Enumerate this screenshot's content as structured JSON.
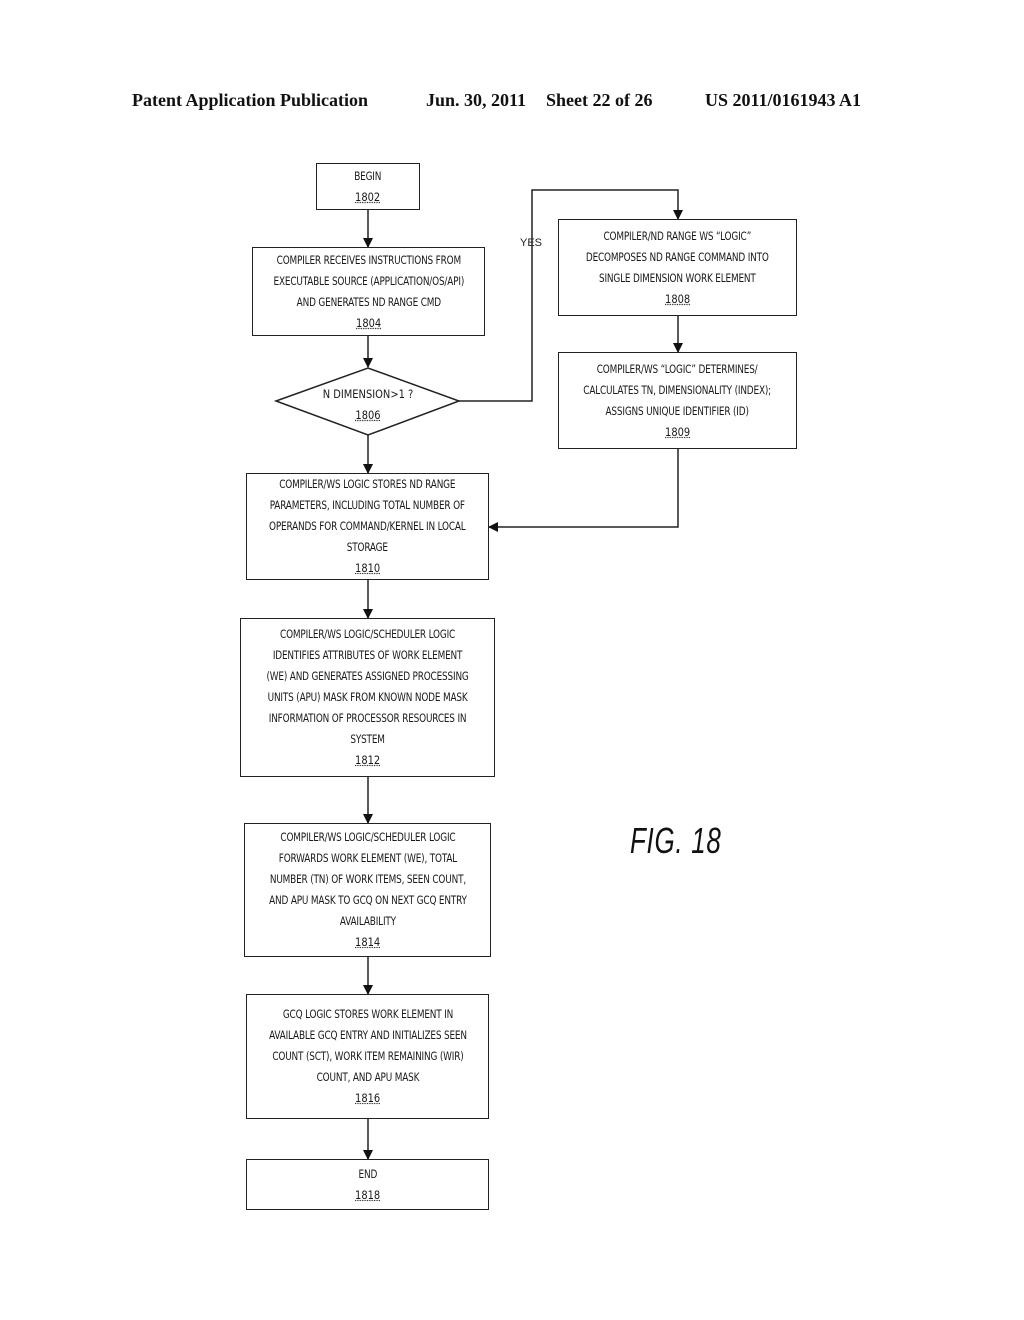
{
  "header": {
    "publication": "Patent Application Publication",
    "date": "Jun. 30, 2011",
    "sheet": "Sheet 22 of 26",
    "number": "US 2011/0161943 A1"
  },
  "figure_label": "FIG. 18",
  "nodes": {
    "begin": {
      "text": "BEGIN",
      "ref": "1802"
    },
    "receive": {
      "text": "COMPILER RECEIVES INSTRUCTIONS FROM\nEXECUTABLE SOURCE (APPLICATION/OS/API)\nAND GENERATES ND RANGE CMD",
      "ref": "1804"
    },
    "decision": {
      "text": "N DIMENSION>1 ?",
      "ref": "1806"
    },
    "decompose": {
      "text": "COMPILER/ND RANGE WS “LOGIC”\nDECOMPOSES ND RANGE COMMAND INTO\nSINGLE DIMENSION WORK ELEMENT",
      "ref": "1808"
    },
    "determine": {
      "text": "COMPILER/WS “LOGIC” DETERMINES/\nCALCULATES TN, DIMENSIONALITY (INDEX);\nASSIGNS UNIQUE IDENTIFIER (ID)",
      "ref": "1809"
    },
    "store_params": {
      "text": "COMPILER/WS LOGIC STORES ND RANGE\nPARAMETERS, INCLUDING TOTAL NUMBER OF\nOPERANDS FOR COMMAND/KERNEL IN LOCAL\nSTORAGE",
      "ref": "1810"
    },
    "identify": {
      "text": "COMPILER/WS LOGIC/SCHEDULER LOGIC\nIDENTIFIES ATTRIBUTES OF WORK ELEMENT\n(WE) AND GENERATES ASSIGNED PROCESSING\nUNITS (APU) MASK FROM KNOWN NODE MASK\nINFORMATION OF PROCESSOR RESOURCES IN\nSYSTEM",
      "ref": "1812"
    },
    "forward": {
      "text": "COMPILER/WS LOGIC/SCHEDULER LOGIC\nFORWARDS WORK ELEMENT (WE), TOTAL\nNUMBER (TN) OF WORK ITEMS, SEEN COUNT,\nAND APU MASK TO GCQ ON NEXT GCQ ENTRY\nAVAILABILITY",
      "ref": "1814"
    },
    "gcq_store": {
      "text": "GCQ LOGIC STORES WORK ELEMENT IN\nAVAILABLE GCQ ENTRY AND INITIALIZES SEEN\nCOUNT (SCT), WORK ITEM REMAINING (WIR)\nCOUNT, AND APU MASK",
      "ref": "1816"
    },
    "end": {
      "text": "END",
      "ref": "1818"
    }
  },
  "edges": {
    "yes_label": "YES"
  }
}
